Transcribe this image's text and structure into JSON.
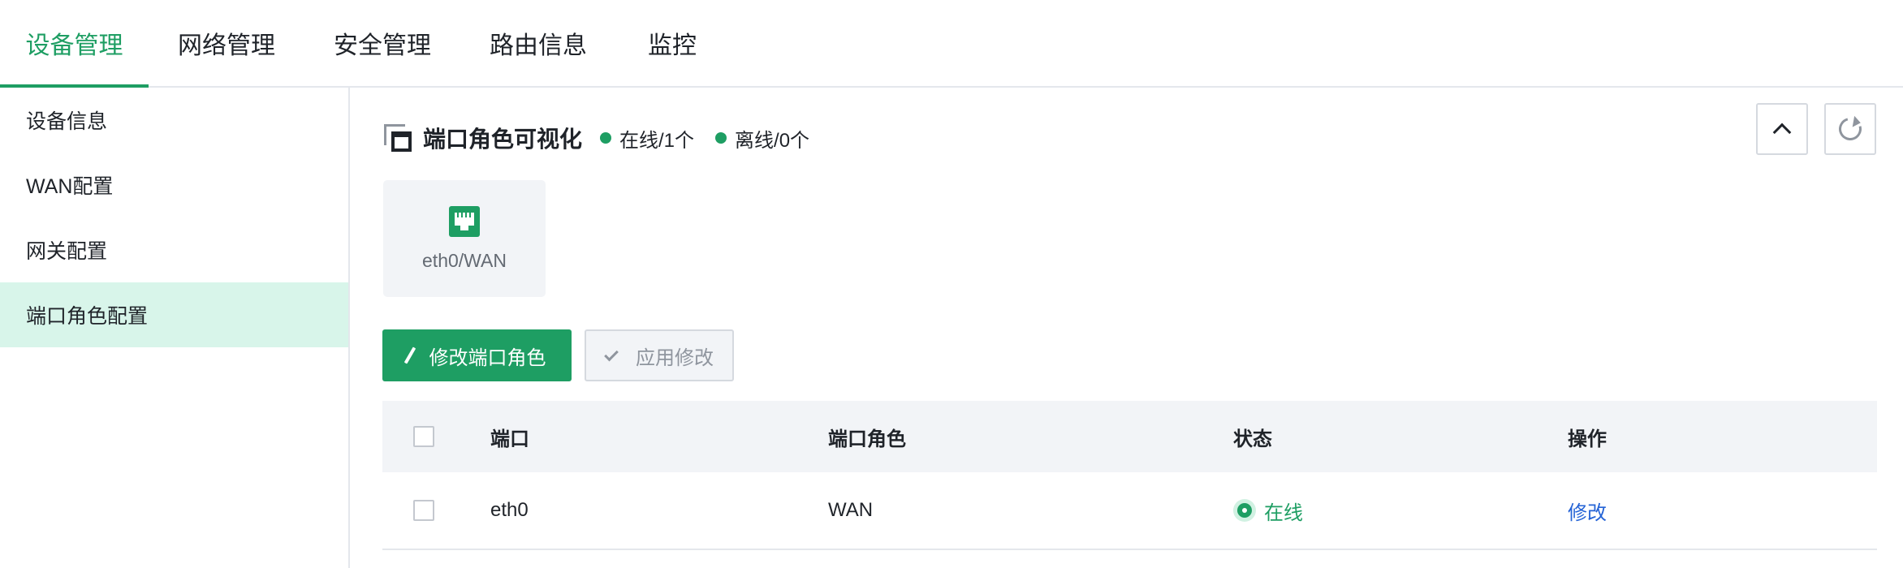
{
  "topnav": {
    "tabs": [
      {
        "label": "设备管理",
        "active": true
      },
      {
        "label": "网络管理",
        "active": false
      },
      {
        "label": "安全管理",
        "active": false
      },
      {
        "label": "路由信息",
        "active": false
      },
      {
        "label": "监控",
        "active": false
      }
    ]
  },
  "sidebar": {
    "items": [
      {
        "label": "设备信息",
        "active": false
      },
      {
        "label": "WAN配置",
        "active": false
      },
      {
        "label": "网关配置",
        "active": false
      },
      {
        "label": "端口角色配置",
        "active": true
      }
    ]
  },
  "panel": {
    "title": "端口角色可视化",
    "online_summary": "在线/1个",
    "offline_summary": "离线/0个",
    "port_cards": [
      {
        "label": "eth0/WAN",
        "icon": "ethernet-port-icon"
      }
    ]
  },
  "actions": {
    "edit_label": "修改端口角色",
    "apply_label": "应用修改"
  },
  "table": {
    "columns": [
      "端口",
      "端口角色",
      "状态",
      "操作"
    ],
    "rows": [
      {
        "port": "eth0",
        "role": "WAN",
        "status": "在线",
        "action": "修改"
      }
    ]
  },
  "colors": {
    "accent": "#1e9e63",
    "sidebar_active_bg": "#d8f5ea",
    "link": "#2463d6",
    "panel_bg": "#f2f4f7"
  }
}
